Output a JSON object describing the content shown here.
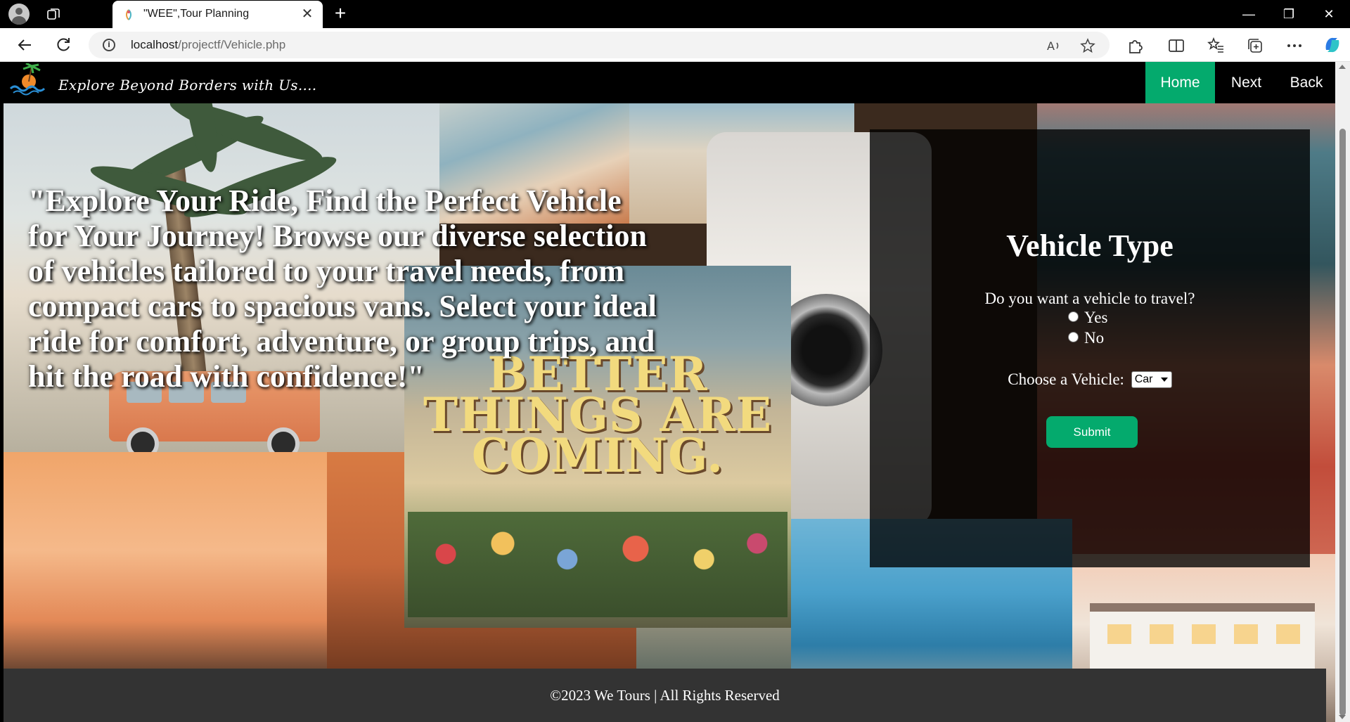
{
  "browser": {
    "tab_title": "\"WEE\",Tour Planning",
    "url_host": "localhost",
    "url_path": "/projectf/Vehicle.php",
    "icons": [
      "profile-icon",
      "workspaces-icon",
      "close-icon",
      "new-tab-icon",
      "minimize-icon",
      "restore-icon",
      "window-close-icon",
      "back-icon",
      "refresh-icon",
      "info-icon",
      "read-aloud-icon",
      "favorite-icon",
      "extensions-icon",
      "split-screen-icon",
      "favorites-icon",
      "collections-icon",
      "more-icon",
      "copilot-icon"
    ]
  },
  "site": {
    "tagline": "Explore Beyond Borders with Us....",
    "nav": {
      "home": "Home",
      "next": "Next",
      "back": "Back",
      "active_color": "#04aa6d"
    }
  },
  "hero": {
    "text": "\"Explore Your Ride, Find the Perfect Vehicle for Your Journey! Browse our diverse selection of vehicles tailored to your travel needs, from compact cars to spacious vans. Select your ideal ride for comfort, adventure, or group trips, and hit the road with confidence!\""
  },
  "background": {
    "sign_text": "BETTER THINGS ARE COMING."
  },
  "form": {
    "title": "Vehicle Type",
    "question": "Do you want a vehicle to travel?",
    "option_yes": "Yes",
    "option_no": "No",
    "choose_label": "Choose a Vehicle:",
    "selected_vehicle": "Car",
    "submit": "Submit",
    "button_color": "#04aa6d"
  },
  "footer": {
    "text": "©2023 We Tours | All Rights Reserved"
  }
}
